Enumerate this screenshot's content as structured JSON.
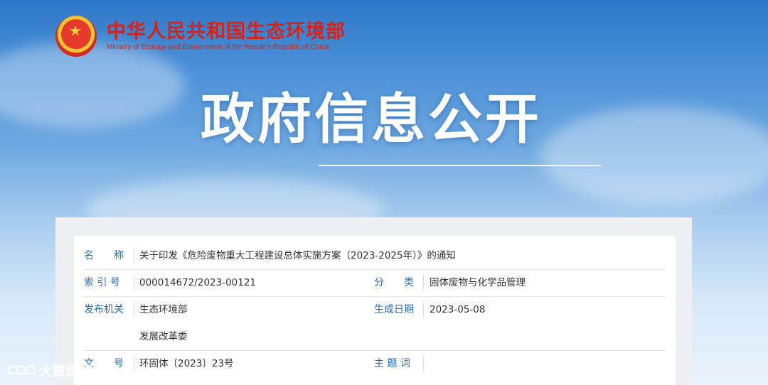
{
  "header": {
    "org_name_cn": "中华人民共和国生态环境部",
    "org_name_en": "Ministry of Ecology and Environment of the People's Republic of China"
  },
  "hero": {
    "title": "政府信息公开"
  },
  "info": {
    "name_label": "名　　称",
    "name_value": "关于印发《危险废物重大工程建设总体实施方案（2023-2025年）》的通知",
    "index_label": "索 引 号",
    "index_value": "000014672/2023-00121",
    "category_label": "分　　类",
    "category_value": "固体废物与化学品管理",
    "issuer_label": "发布机关",
    "issuer_value_1": "生态环境部",
    "issuer_value_2": "发展改革委",
    "date_label": "生成日期",
    "date_value": "2023-05-08",
    "doc_no_label": "文　　号",
    "doc_no_value": "环固体〔2023〕23号",
    "subject_label": "主 题 词",
    "subject_value": ""
  },
  "watermark": {
    "logo": "ᑕᗝᗝ",
    "text": "大数跨境"
  },
  "colors": {
    "brand_red": "#d52317",
    "label_blue": "#2b6db4"
  }
}
